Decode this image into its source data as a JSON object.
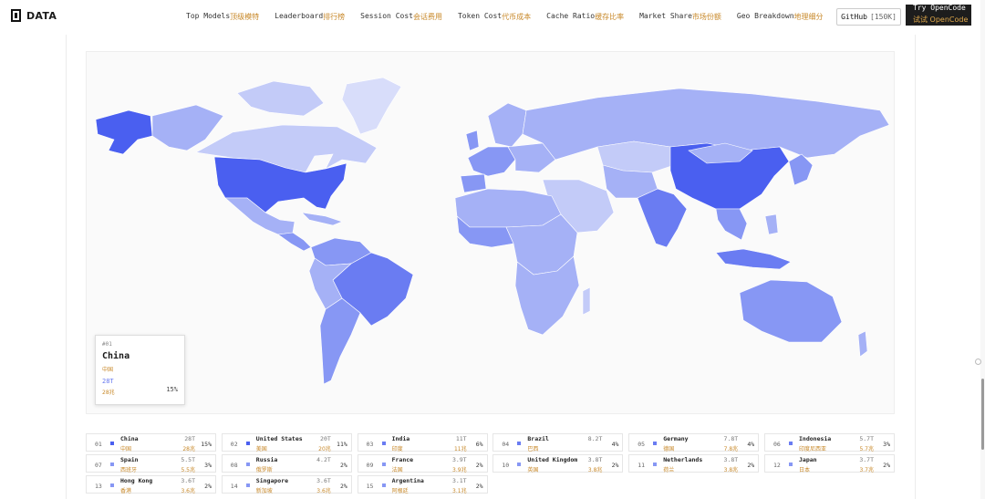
{
  "brand": {
    "name": "DATA"
  },
  "nav": [
    {
      "en": "Top Models",
      "zh": "顶级模特"
    },
    {
      "en": "Leaderboard",
      "zh": "排行榜"
    },
    {
      "en": "Session Cost",
      "zh": "会话费用"
    },
    {
      "en": "Token Cost",
      "zh": "代币成本"
    },
    {
      "en": "Cache Ratio",
      "zh": "缓存比率"
    },
    {
      "en": "Market Share",
      "zh": "市场份额"
    },
    {
      "en": "Geo Breakdown",
      "zh": "地理细分"
    }
  ],
  "github": {
    "label": "GitHub",
    "stars": "[150K]"
  },
  "try": {
    "en": "Try OpenCode",
    "zh": "试试 OpenCode"
  },
  "colors": {
    "c1": "#4a5ff0",
    "c2": "#6a7cf2",
    "c3": "#8797f4",
    "c4": "#a5b1f6",
    "c5": "#c3cbf8",
    "c6": "#d8ddfa",
    "border": "#ffffff"
  },
  "tooltip": {
    "rank": "#01",
    "name": "China",
    "zh": "中国",
    "value": "28T",
    "value_zh": "28兆",
    "pct": "15%"
  },
  "countries": [
    {
      "rank": "01",
      "name": "China",
      "zh": "中国",
      "value": "28T",
      "value_zh": "28兆",
      "pct": "15%"
    },
    {
      "rank": "02",
      "name": "United States",
      "zh": "美国",
      "value": "20T",
      "value_zh": "20兆",
      "pct": "11%"
    },
    {
      "rank": "03",
      "name": "India",
      "zh": "印度",
      "value": "11T",
      "value_zh": "11兆",
      "pct": "6%"
    },
    {
      "rank": "04",
      "name": "Brazil",
      "zh": "巴西",
      "value": "8.2T",
      "value_zh": "",
      "pct": "4%"
    },
    {
      "rank": "05",
      "name": "Germany",
      "zh": "德国",
      "value": "7.8T",
      "value_zh": "7.8兆",
      "pct": "4%"
    },
    {
      "rank": "06",
      "name": "Indonesia",
      "zh": "印度尼西亚",
      "value": "5.7T",
      "value_zh": "5.7兆",
      "pct": "3%"
    },
    {
      "rank": "07",
      "name": "Spain",
      "zh": "西班牙",
      "value": "5.5T",
      "value_zh": "5.5兆",
      "pct": "3%"
    },
    {
      "rank": "08",
      "name": "Russia",
      "zh": "俄罗斯",
      "value": "4.2T",
      "value_zh": "",
      "pct": "2%"
    },
    {
      "rank": "09",
      "name": "France",
      "zh": "法国",
      "value": "3.9T",
      "value_zh": "3.9兆",
      "pct": "2%"
    },
    {
      "rank": "10",
      "name": "United Kingdom",
      "zh": "英国",
      "value": "3.8T",
      "value_zh": "3.8兆",
      "pct": "2%"
    },
    {
      "rank": "11",
      "name": "Netherlands",
      "zh": "荷兰",
      "value": "3.8T",
      "value_zh": "3.8兆",
      "pct": "2%"
    },
    {
      "rank": "12",
      "name": "Japan",
      "zh": "日本",
      "value": "3.7T",
      "value_zh": "3.7兆",
      "pct": "2%"
    },
    {
      "rank": "13",
      "name": "Hong Kong",
      "zh": "香港",
      "value": "3.6T",
      "value_zh": "3.6兆",
      "pct": "2%"
    },
    {
      "rank": "14",
      "name": "Singapore",
      "zh": "新加坡",
      "value": "3.6T",
      "value_zh": "3.6兆",
      "pct": "2%"
    },
    {
      "rank": "15",
      "name": "Argentina",
      "zh": "阿根廷",
      "value": "3.1T",
      "value_zh": "3.1兆",
      "pct": "2%"
    }
  ]
}
